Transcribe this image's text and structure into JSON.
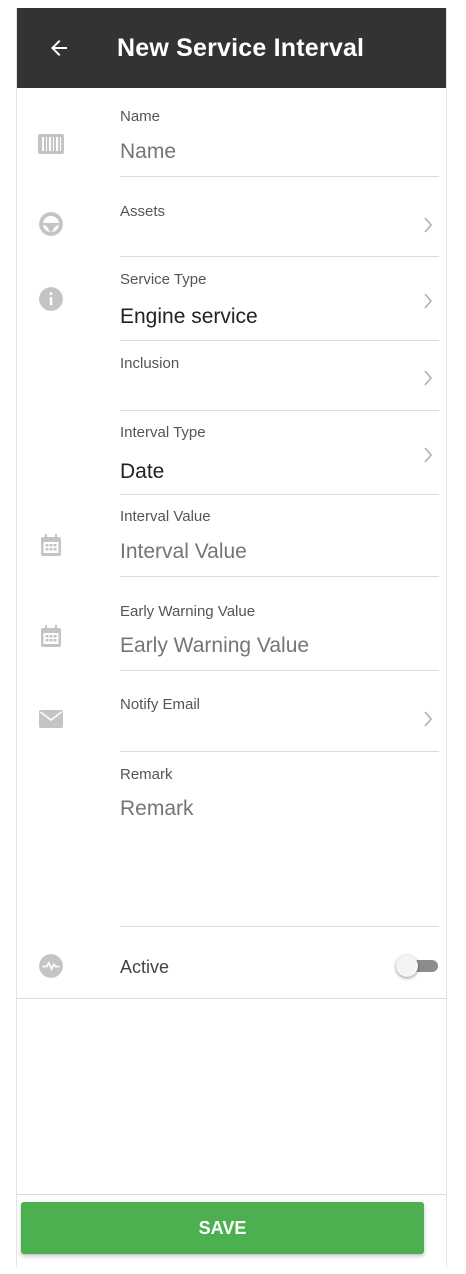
{
  "header": {
    "title": "New Service Interval"
  },
  "fields": {
    "name": {
      "label": "Name",
      "placeholder": "Name"
    },
    "assets": {
      "label": "Assets"
    },
    "service_type": {
      "label": "Service Type",
      "value": "Engine service"
    },
    "inclusion": {
      "label": "Inclusion"
    },
    "interval_type": {
      "label": "Interval Type",
      "value": "Date"
    },
    "interval_value": {
      "label": "Interval Value",
      "placeholder": "Interval Value"
    },
    "early_warning": {
      "label": "Early Warning Value",
      "placeholder": "Early Warning Value"
    },
    "notify_email": {
      "label": "Notify Email"
    },
    "remark": {
      "label": "Remark",
      "placeholder": "Remark"
    }
  },
  "active": {
    "label": "Active",
    "on": false
  },
  "save": {
    "label": "SAVE"
  },
  "colors": {
    "appbar": "#333333",
    "save": "#4caf50",
    "icon": "#c4c4c4"
  }
}
